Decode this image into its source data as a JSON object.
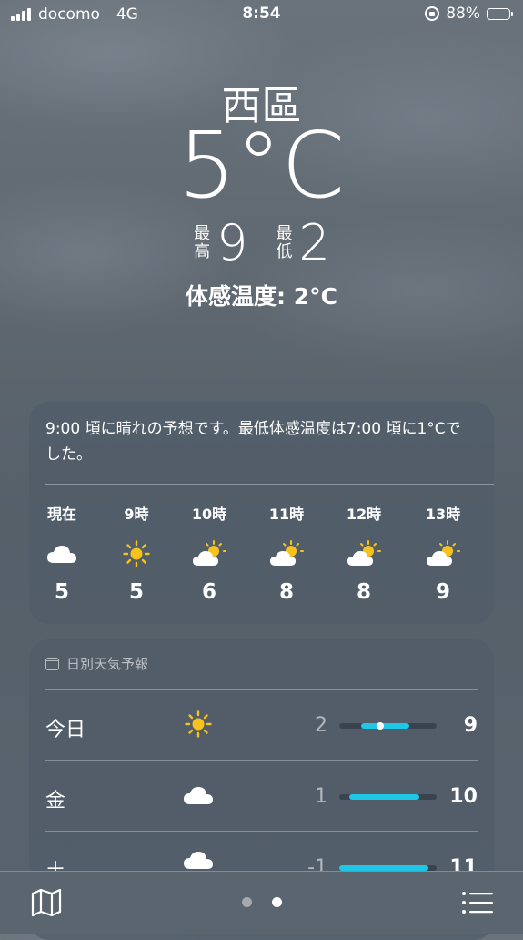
{
  "status_bar": {
    "carrier": "docomo",
    "network": "4G",
    "time": "8:54",
    "battery": "88%",
    "battery_color": "#f5c518"
  },
  "header": {
    "city": "西區",
    "temperature": "5°C",
    "high_label": "最高",
    "high": "9",
    "low_label": "最低",
    "low": "2",
    "feels_like": "体感温度: 2°C"
  },
  "hourly": {
    "summary": "9:00 頃に晴れの予想です。最低体感温度は7:00 頃に1°Cでした。",
    "items": [
      {
        "label": "現在",
        "icon": "cloud-icon",
        "temp": "5"
      },
      {
        "label": "9時",
        "icon": "sun-icon",
        "temp": "5"
      },
      {
        "label": "10時",
        "icon": "partly-sunny-icon",
        "temp": "6"
      },
      {
        "label": "11時",
        "icon": "partly-sunny-icon",
        "temp": "8"
      },
      {
        "label": "12時",
        "icon": "partly-sunny-icon",
        "temp": "8"
      },
      {
        "label": "13時",
        "icon": "partly-sunny-icon",
        "temp": "9"
      }
    ]
  },
  "daily": {
    "title": "日別天気予報",
    "range_color": "#1fc7e6",
    "items": [
      {
        "day": "今日",
        "icon": "sun-icon",
        "min": "2",
        "max": "9",
        "range_start": 0.22,
        "range_end": 0.72,
        "current": 0.42
      },
      {
        "day": "金",
        "icon": "cloud-icon",
        "min": "1",
        "max": "10",
        "range_start": 0.1,
        "range_end": 0.82
      },
      {
        "day": "土",
        "icon": "rain-cloud-icon",
        "min": "-1",
        "max": "11",
        "range_start": 0.0,
        "range_end": 0.92
      }
    ]
  },
  "bottom_bar": {
    "page_count": 2,
    "active_page": 2,
    "icons": [
      "map-icon",
      "list-icon"
    ]
  }
}
